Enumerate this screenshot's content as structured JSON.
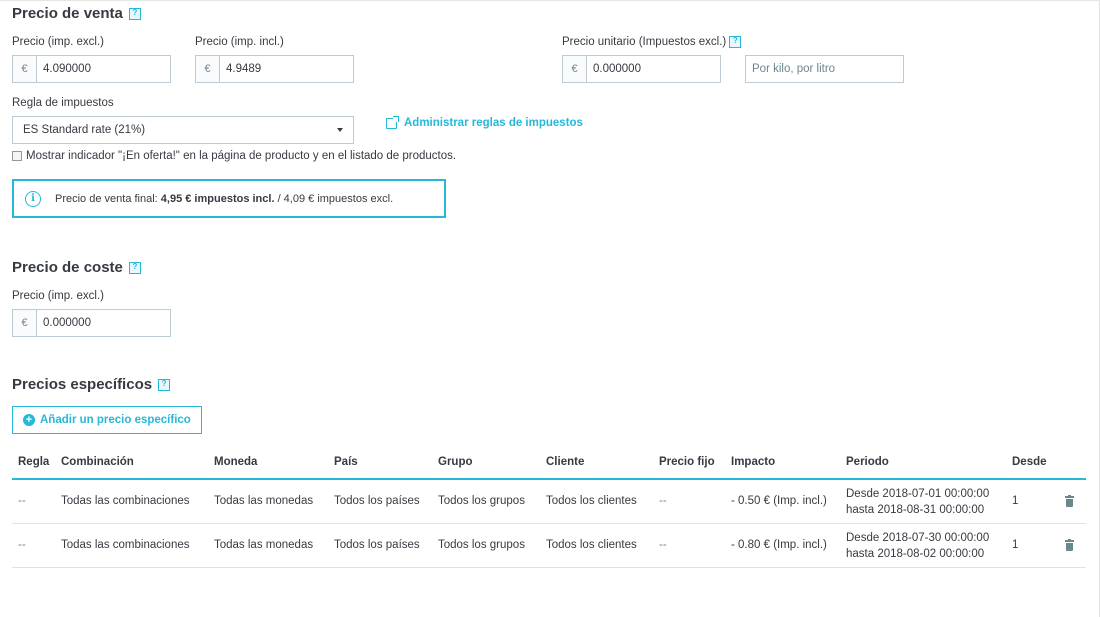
{
  "sale_price": {
    "title": "Precio de venta",
    "tax_excl_label": "Precio (imp. excl.)",
    "tax_excl_currency": "€",
    "tax_excl_value": "4.090000",
    "tax_incl_label": "Precio (imp. incl.)",
    "tax_incl_currency": "€",
    "tax_incl_value": "4.9489",
    "unit_price_label": "Precio unitario (Impuestos excl.)",
    "unit_price_currency": "€",
    "unit_price_value": "0.000000",
    "unity_placeholder": "Por kilo, por litro",
    "tax_rule_label": "Regla de impuestos",
    "tax_rule_selected": "ES Standard rate (21%)",
    "manage_tax_rules_link": "Administrar reglas de impuestos",
    "on_sale_checkbox_label": "Mostrar indicador \"¡En oferta!\" en la página de producto y en el listado de productos.",
    "on_sale_checked": false,
    "final_price_prefix": "Precio de venta final: ",
    "final_price_incl": "4,95 € impuestos incl.",
    "final_price_excl": " / 4,09 € impuestos excl."
  },
  "cost_price": {
    "title": "Precio de coste",
    "label": "Precio (imp. excl.)",
    "currency": "€",
    "value": "0.000000"
  },
  "specific_prices": {
    "title": "Precios específicos",
    "add_button": "Añadir un precio específico",
    "columns": [
      "Regla",
      "Combinación",
      "Moneda",
      "País",
      "Grupo",
      "Cliente",
      "Precio fijo",
      "Impacto",
      "Periodo",
      "Desde"
    ],
    "rows": [
      {
        "rule": "--",
        "combination": "Todas las combinaciones",
        "currency": "Todas las monedas",
        "country": "Todos los países",
        "group": "Todos los grupos",
        "customer": "Todos los clientes",
        "fixed_price": "--",
        "impact": "- 0.50 € (Imp. incl.)",
        "period_from": "Desde 2018-07-01 00:00:00",
        "period_to": "hasta 2018-08-31 00:00:00",
        "from_qty": "1"
      },
      {
        "rule": "--",
        "combination": "Todas las combinaciones",
        "currency": "Todas las monedas",
        "country": "Todos los países",
        "group": "Todos los grupos",
        "customer": "Todos los clientes",
        "fixed_price": "--",
        "impact": "- 0.80 € (Imp. incl.)",
        "period_from": "Desde 2018-07-30 00:00:00",
        "period_to": "hasta 2018-08-02 00:00:00",
        "from_qty": "1"
      }
    ]
  },
  "colors": {
    "accent": "#25b9d7",
    "text": "#363a41",
    "muted": "#6c868e",
    "border": "#bbcdd2"
  }
}
